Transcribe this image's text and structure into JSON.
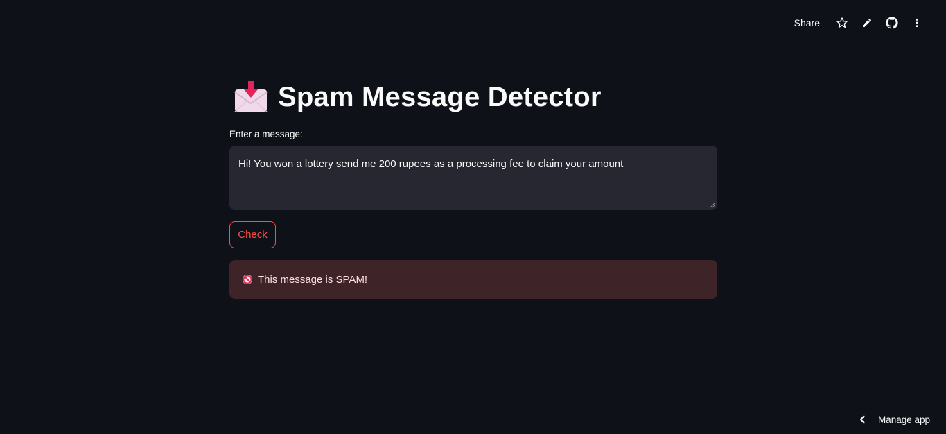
{
  "toolbar": {
    "share_label": "Share",
    "icons": [
      "star-icon",
      "pencil-icon",
      "github-icon",
      "more-vertical-icon"
    ]
  },
  "header": {
    "emoji": "envelope-with-arrow-icon",
    "title": "Spam Message Detector"
  },
  "form": {
    "input_label": "Enter a message:",
    "message_value": "Hi! You won a lottery send me 200 rupees as a processing fee to claim your amount",
    "check_label": "Check"
  },
  "result": {
    "icon": "no-entry-icon",
    "text": "This message is SPAM!"
  },
  "footer": {
    "manage_label": "Manage app"
  },
  "colors": {
    "background": "#0e1117",
    "input_bg": "#262730",
    "accent": "#ff4b4b",
    "error_bg": "#3d2328"
  }
}
